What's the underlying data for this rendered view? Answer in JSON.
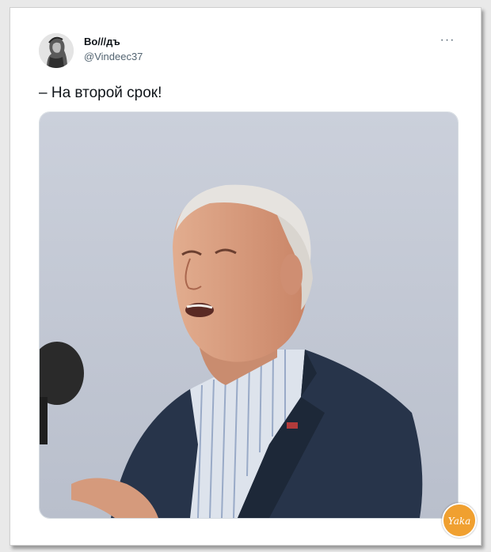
{
  "tweet": {
    "display_name": "Во///дъ",
    "handle": "@Vindeec37",
    "text": "– На второй срок!",
    "more_label": "···",
    "avatar_icon": "engraved-portrait-avatar",
    "photo_subject": "elderly-man-speaking-at-microphone",
    "photo_sky_color": "#c9ced9"
  },
  "watermark": {
    "logo_text": "Yaka",
    "color": "#f0a030"
  }
}
